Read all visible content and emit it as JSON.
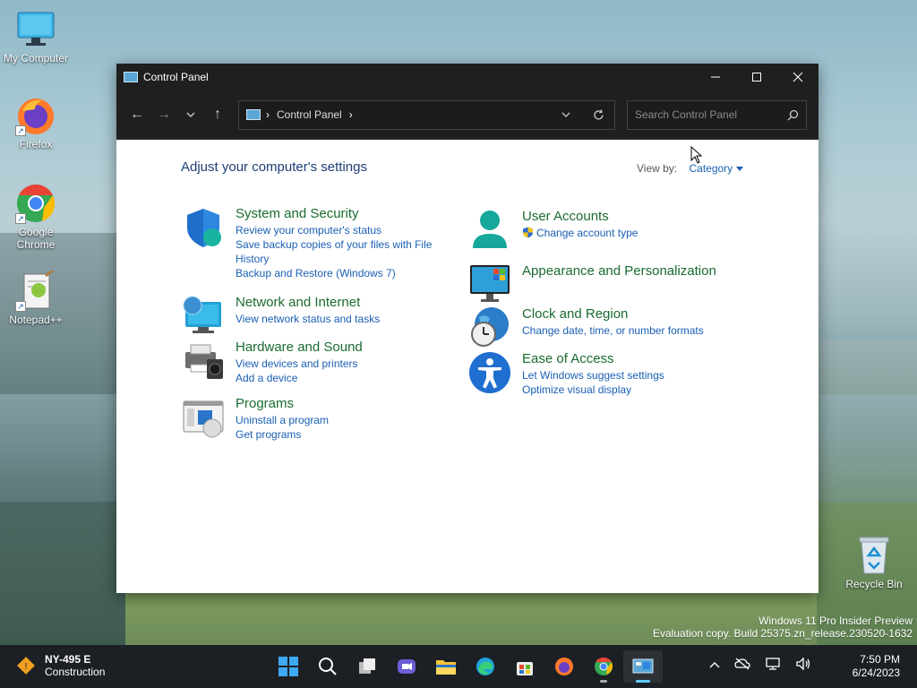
{
  "desktop": {
    "icons": [
      {
        "label": "My Computer",
        "icon": "monitor-icon"
      },
      {
        "label": "Firefox",
        "icon": "firefox-icon"
      },
      {
        "label": "Google Chrome",
        "icon": "chrome-icon"
      },
      {
        "label": "Notepad++",
        "icon": "notepadpp-icon"
      }
    ],
    "recycle_bin": "Recycle Bin",
    "watermark": {
      "line1": "Windows 11 Pro Insider Preview",
      "line2": "Evaluation copy. Build 25375.zn_release.230520-1632"
    }
  },
  "window": {
    "title": "Control Panel",
    "breadcrumb": "Control Panel",
    "search_placeholder": "Search Control Panel",
    "heading": "Adjust your computer's settings",
    "view_by_label": "View by:",
    "view_by_value": "Category",
    "categories": [
      {
        "title": "System and Security",
        "links": [
          "Review your computer's status",
          "Save backup copies of your files with File History",
          "Backup and Restore (Windows 7)"
        ]
      },
      {
        "title": "Network and Internet",
        "links": [
          "View network status and tasks"
        ]
      },
      {
        "title": "Hardware and Sound",
        "links": [
          "View devices and printers",
          "Add a device"
        ]
      },
      {
        "title": "Programs",
        "links": [
          "Uninstall a program",
          "Get programs"
        ]
      },
      {
        "title": "User Accounts",
        "links": [
          "Change account type"
        ]
      },
      {
        "title": "Appearance and Personalization",
        "links": []
      },
      {
        "title": "Clock and Region",
        "links": [
          "Change date, time, or number formats"
        ]
      },
      {
        "title": "Ease of Access",
        "links": [
          "Let Windows suggest settings",
          "Optimize visual display"
        ]
      }
    ]
  },
  "taskbar": {
    "weather_title": "NY-495 E",
    "weather_sub": "Construction",
    "time": "7:50 PM",
    "date": "6/24/2023"
  },
  "colors": {
    "link": "#1a5fb4",
    "category_title": "#1a6b2f",
    "heading": "#1e3e74",
    "titlebar": "#1f1f1f",
    "taskbar": "#1c2024",
    "active_indicator": "#60cdff"
  }
}
